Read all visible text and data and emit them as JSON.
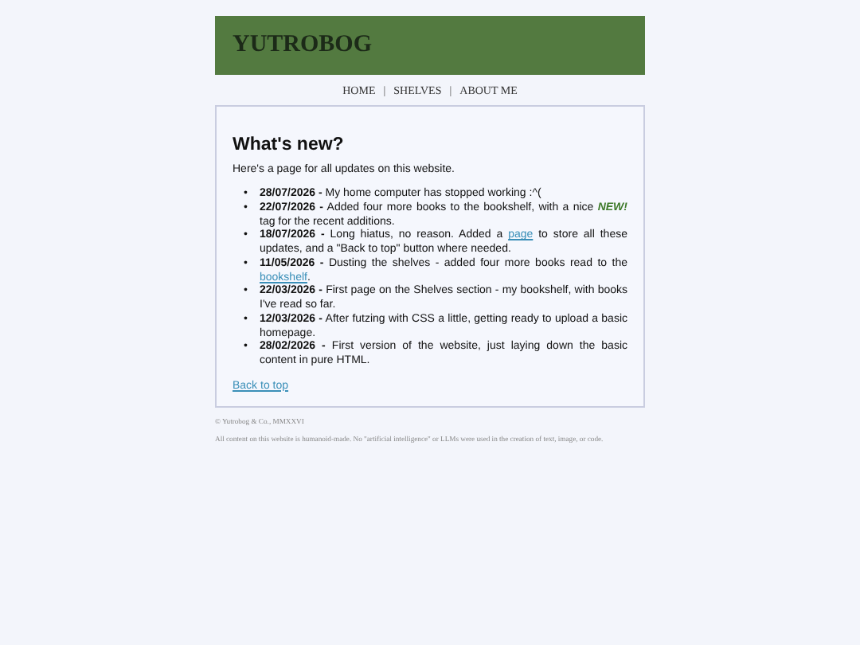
{
  "header": {
    "title": "YUTROBOG"
  },
  "nav": [
    {
      "label": "HOME"
    },
    {
      "label": "|",
      "kind": "sep"
    },
    {
      "label": "SHELVES"
    },
    {
      "label": "|",
      "kind": "sep"
    },
    {
      "label": "ABOUT ME"
    }
  ],
  "main": {
    "heading": "What's new?",
    "intro": "Here's a page for all updates on this website.",
    "updates": [
      {
        "bullet": "•",
        "date": "28/07/2026 -",
        "parts": [
          {
            "kind": "text",
            "text": "My home computer has stopped working :^("
          }
        ]
      },
      {
        "bullet": "•",
        "date": "22/07/2026 -",
        "parts": [
          {
            "kind": "text",
            "text": "Added four more books to the bookshelf, with a nice"
          },
          {
            "kind": "tag",
            "text": "NEW!"
          },
          {
            "kind": "text",
            "text": "tag for the recent additions."
          }
        ]
      },
      {
        "bullet": "•",
        "date": "18/07/2026 -",
        "parts": [
          {
            "kind": "text",
            "text": "Long hiatus, no reason. Added a"
          },
          {
            "kind": "link",
            "text": "page"
          },
          {
            "kind": "text",
            "text": "to store all these updates, and a \"Back to top\" button where needed."
          }
        ]
      },
      {
        "bullet": "•",
        "date": "11/05/2026 -",
        "parts": [
          {
            "kind": "text",
            "text": "Dusting the shelves - added four more books read to the"
          },
          {
            "kind": "link",
            "text": "bookshelf"
          },
          {
            "kind": "text",
            "text": "."
          }
        ]
      },
      {
        "bullet": "•",
        "date": "22/03/2026 -",
        "parts": [
          {
            "kind": "text",
            "text": "First page on the Shelves section - my bookshelf, with books I've read so far."
          }
        ]
      },
      {
        "bullet": "•",
        "date": "12/03/2026 -",
        "parts": [
          {
            "kind": "text",
            "text": "After futzing with CSS a little, getting ready to upload a basic homepage."
          }
        ]
      },
      {
        "bullet": "•",
        "date": "28/02/2026 -",
        "parts": [
          {
            "kind": "text",
            "text": "First version of the website, just laying down the basic content in pure HTML."
          }
        ]
      }
    ],
    "back_to_top": "Back to top"
  },
  "footer": {
    "copyright": "© Yutrobog & Co., MMXXVI",
    "notice": "All content on this website is humanoid-made. No \"artificial intelligence\" or LLMs were used in the creation of text, image, or code."
  }
}
